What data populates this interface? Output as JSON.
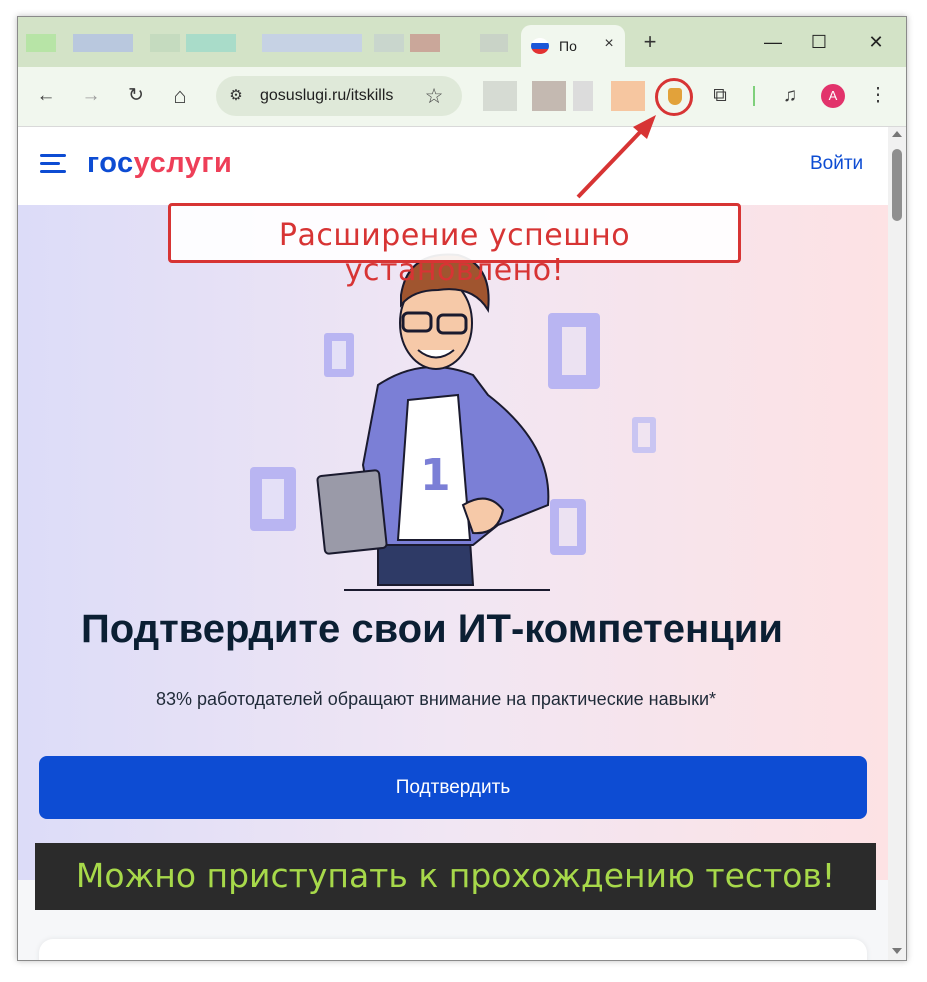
{
  "browser": {
    "tab": {
      "title": "По",
      "close_icon": "×"
    },
    "new_tab_icon": "+",
    "window_controls": {
      "minimize": "—",
      "maximize": "☐",
      "close": "✕"
    },
    "toolbar": {
      "back_icon": "←",
      "forward_icon": "→",
      "reload_icon": "↻",
      "home_icon": "⌂",
      "url": "gosuslugi.ru/itskills",
      "bookmark_icon": "☆",
      "extensions_icon": "⧉",
      "media_icon": "♫",
      "profile_initial": "A",
      "menu_icon": "⋮"
    }
  },
  "site": {
    "logo_part1": "гос",
    "logo_part2": "услуги",
    "login_label": "Войти",
    "hero_title": "Подтвердите свои ИТ-компетенции",
    "hero_subtitle": "83% работодателей обращают внимание на практические навыки*",
    "confirm_button": "Подтвердить"
  },
  "annotations": {
    "callout": "Расширение успешно установлено!",
    "banner": "Можно приступать к прохождению тестов!"
  },
  "colors": {
    "brand_blue": "#0d4cd3",
    "brand_red": "#ee3f58",
    "annotation_red": "#d73434",
    "banner_green": "#a7d94a"
  }
}
